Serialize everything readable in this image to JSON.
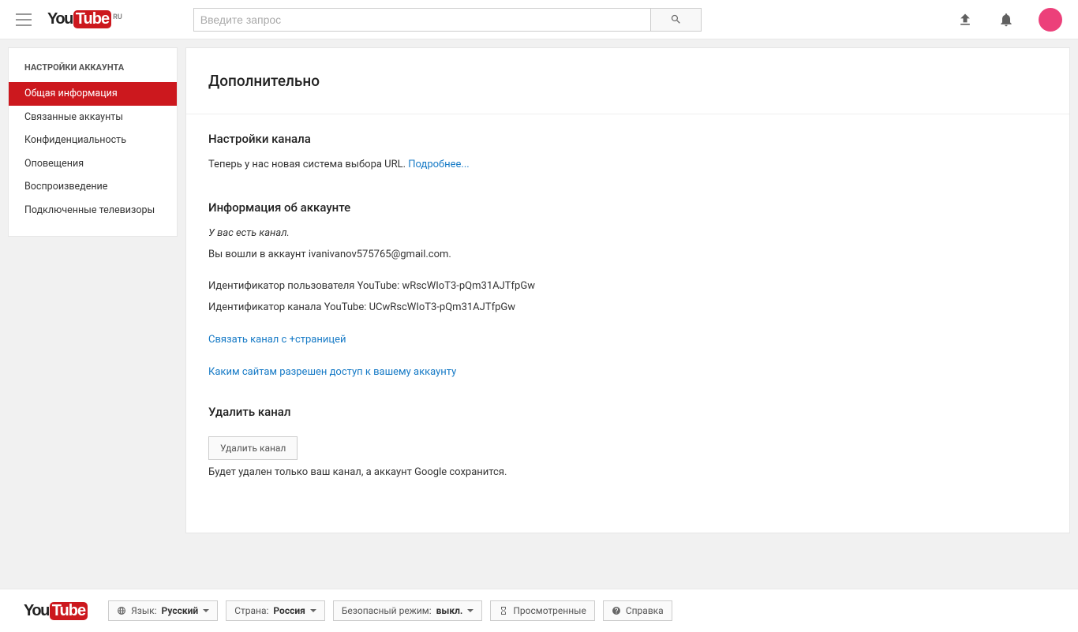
{
  "header": {
    "logo_region": "RU",
    "search_placeholder": "Введите запрос"
  },
  "sidebar": {
    "title": "НАСТРОЙКИ АККАУНТА",
    "items": [
      {
        "label": "Общая информация",
        "active": true
      },
      {
        "label": "Связанные аккаунты",
        "active": false
      },
      {
        "label": "Конфиденциальность",
        "active": false
      },
      {
        "label": "Оповещения",
        "active": false
      },
      {
        "label": "Воспроизведение",
        "active": false
      },
      {
        "label": "Подключенные телевизоры",
        "active": false
      }
    ]
  },
  "main": {
    "title": "Дополнительно",
    "channel_settings_heading": "Настройки канала",
    "url_msg": "Теперь у нас новая система выбора URL. ",
    "url_more": "Подробнее...",
    "account_info_heading": "Информация об аккаунте",
    "have_channel": "У вас есть канал.",
    "logged_in_as": "Вы вошли в аккаунт ivanivanov575765@gmail.com.",
    "user_id_line": "Идентификатор пользователя YouTube: wRscWIoT3-pQm31AJTfpGw",
    "channel_id_line": "Идентификатор канала YouTube: UCwRscWIoT3-pQm31AJTfpGw",
    "link_to_plus": "Связать канал с +страницей",
    "which_sites": "Каким сайтам разрешен доступ к вашему аккаунту",
    "delete_heading": "Удалить канал",
    "delete_btn": "Удалить канал",
    "delete_note": "Будет удален только ваш канал, а аккаунт Google сохранится."
  },
  "footer": {
    "language_label": "Язык: ",
    "language_value": "Русский",
    "country_label": "Страна: ",
    "country_value": "Россия",
    "safe_label": "Безопасный режим: ",
    "safe_value": "выкл.",
    "history": "Просмотренные",
    "help": "Справка"
  }
}
